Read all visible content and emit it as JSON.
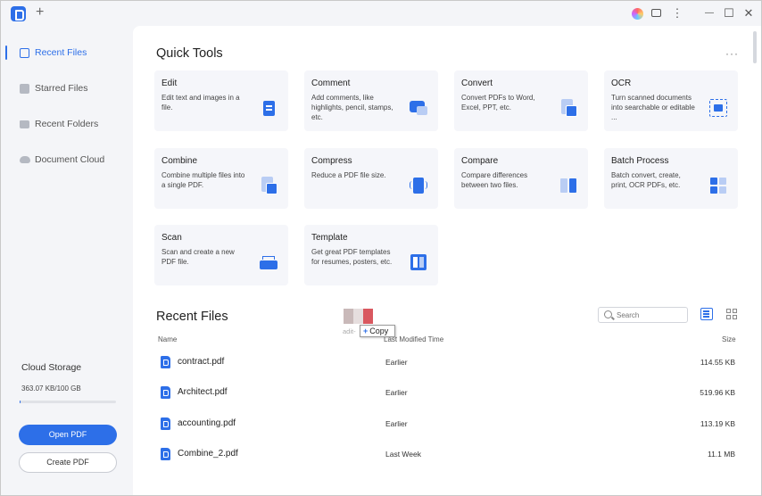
{
  "titlebar": {
    "new_tab": "+",
    "menu": "⋮",
    "minimize": "—",
    "maximize": "☐",
    "close": "✕"
  },
  "sidebar": {
    "items": [
      {
        "label": "Recent Files",
        "icon": "document-icon",
        "active": true
      },
      {
        "label": "Starred Files",
        "icon": "star-icon",
        "active": false
      },
      {
        "label": "Recent Folders",
        "icon": "folder-icon",
        "active": false
      },
      {
        "label": "Document Cloud",
        "icon": "cloud-icon",
        "active": false
      }
    ],
    "storage_title": "Cloud Storage",
    "storage_value": "363.07 KB/100 GB",
    "storage_used_fraction": 0.003,
    "open_pdf": "Open PDF",
    "create_pdf": "Create PDF"
  },
  "quick_tools": {
    "title": "Quick Tools",
    "more": "···",
    "tools": [
      {
        "title": "Edit",
        "desc": "Edit text and images in a file."
      },
      {
        "title": "Comment",
        "desc": "Add comments, like highlights, pencil, stamps, etc."
      },
      {
        "title": "Convert",
        "desc": "Convert PDFs to Word, Excel, PPT, etc."
      },
      {
        "title": "OCR",
        "desc": "Turn scanned documents into searchable or editable ..."
      },
      {
        "title": "Combine",
        "desc": "Combine multiple files into a single PDF."
      },
      {
        "title": "Compress",
        "desc": "Reduce a PDF file size."
      },
      {
        "title": "Compare",
        "desc": "Compare differences between two files."
      },
      {
        "title": "Batch Process",
        "desc": "Batch convert, create, print, OCR PDFs, etc."
      },
      {
        "title": "Scan",
        "desc": "Scan and create a new PDF file."
      },
      {
        "title": "Template",
        "desc": "Get great PDF templates for resumes, posters, etc."
      }
    ]
  },
  "recent_files": {
    "title": "Recent Files",
    "search_placeholder": "Search",
    "columns": {
      "name": "Name",
      "modified": "Last Modified Time",
      "size": "Size"
    },
    "rows": [
      {
        "name": "contract.pdf",
        "modified": "Earlier",
        "size": "114.55 KB"
      },
      {
        "name": "Architect.pdf",
        "modified": "Earlier",
        "size": "519.96 KB"
      },
      {
        "name": "accounting.pdf",
        "modified": "Earlier",
        "size": "113.19 KB"
      },
      {
        "name": "Combine_2.pdf",
        "modified": "Last Week",
        "size": "11.1 MB"
      }
    ]
  },
  "drag": {
    "file_label": "adit-",
    "copy_label": "Copy"
  },
  "colors": {
    "accent": "#2d6fe8",
    "sidebar_bg": "#f4f5f8",
    "card_bg": "#f5f6fa"
  }
}
